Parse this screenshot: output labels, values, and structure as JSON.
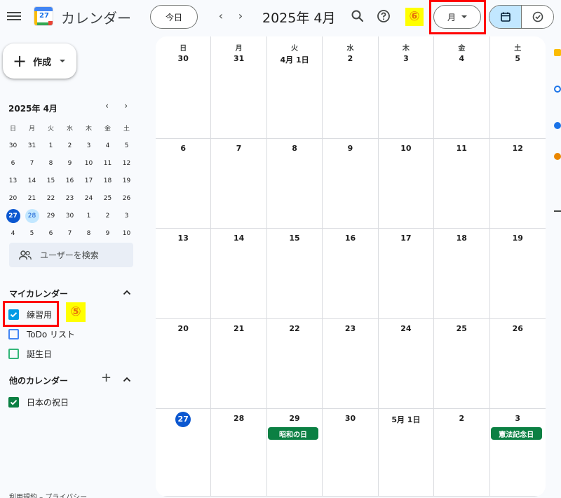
{
  "header": {
    "logo_day": "27",
    "app_title": "カレンダー",
    "today_label": "今日",
    "prev_label": "‹",
    "next_label": "›",
    "current_month": "2025年 4月",
    "badge_6": "⑥",
    "view_label": "月"
  },
  "sidebar": {
    "create_label": "作成",
    "mini_title": "2025年 4月",
    "mini_prev": "‹",
    "mini_next": "›",
    "mini_dow": [
      "日",
      "月",
      "火",
      "水",
      "木",
      "金",
      "土"
    ],
    "mini_weeks": [
      [
        "30",
        "31",
        "1",
        "2",
        "3",
        "4",
        "5"
      ],
      [
        "6",
        "7",
        "8",
        "9",
        "10",
        "11",
        "12"
      ],
      [
        "13",
        "14",
        "15",
        "16",
        "17",
        "18",
        "19"
      ],
      [
        "20",
        "21",
        "22",
        "23",
        "24",
        "25",
        "26"
      ],
      [
        "27",
        "28",
        "29",
        "30",
        "1",
        "2",
        "3"
      ],
      [
        "4",
        "5",
        "6",
        "7",
        "8",
        "9",
        "10"
      ]
    ],
    "mini_today": "27",
    "mini_selected": "28",
    "search_people_label": "ユーザーを検索",
    "my_calendars_title": "マイカレンダー",
    "my_calendars": [
      {
        "label": "練習用",
        "checked": true,
        "color": "#039be5"
      },
      {
        "label": "ToDo リスト",
        "checked": false,
        "color": "#4285f4"
      },
      {
        "label": "誕生日",
        "checked": false,
        "color": "#33b679"
      }
    ],
    "badge_5": "⑤",
    "other_calendars_title": "他のカレンダー",
    "other_calendars": [
      {
        "label": "日本の祝日",
        "checked": true,
        "color": "#0b8043"
      }
    ],
    "footer": "利用規約 – プライバシー"
  },
  "month": {
    "dow": [
      "日",
      "月",
      "火",
      "水",
      "木",
      "金",
      "土"
    ],
    "weeks": [
      [
        "30",
        "31",
        "4月 1日",
        "2",
        "3",
        "4",
        "5"
      ],
      [
        "6",
        "7",
        "8",
        "9",
        "10",
        "11",
        "12"
      ],
      [
        "13",
        "14",
        "15",
        "16",
        "17",
        "18",
        "19"
      ],
      [
        "20",
        "21",
        "22",
        "23",
        "24",
        "25",
        "26"
      ],
      [
        "27",
        "28",
        "29",
        "30",
        "5月 1日",
        "2",
        "3"
      ]
    ],
    "today": {
      "week": 4,
      "day": 0
    },
    "events": [
      {
        "week": 4,
        "day": 2,
        "label": "昭和の日",
        "color": "#0b8043"
      },
      {
        "week": 4,
        "day": 6,
        "label": "憲法記念日",
        "color": "#0b8043"
      }
    ]
  },
  "colors": {
    "accent": "#0b57d0",
    "selected_bg": "#c2e7ff",
    "holiday": "#0b8043",
    "highlight_red": "#ff0000",
    "badge_yellow": "#ffff00"
  }
}
